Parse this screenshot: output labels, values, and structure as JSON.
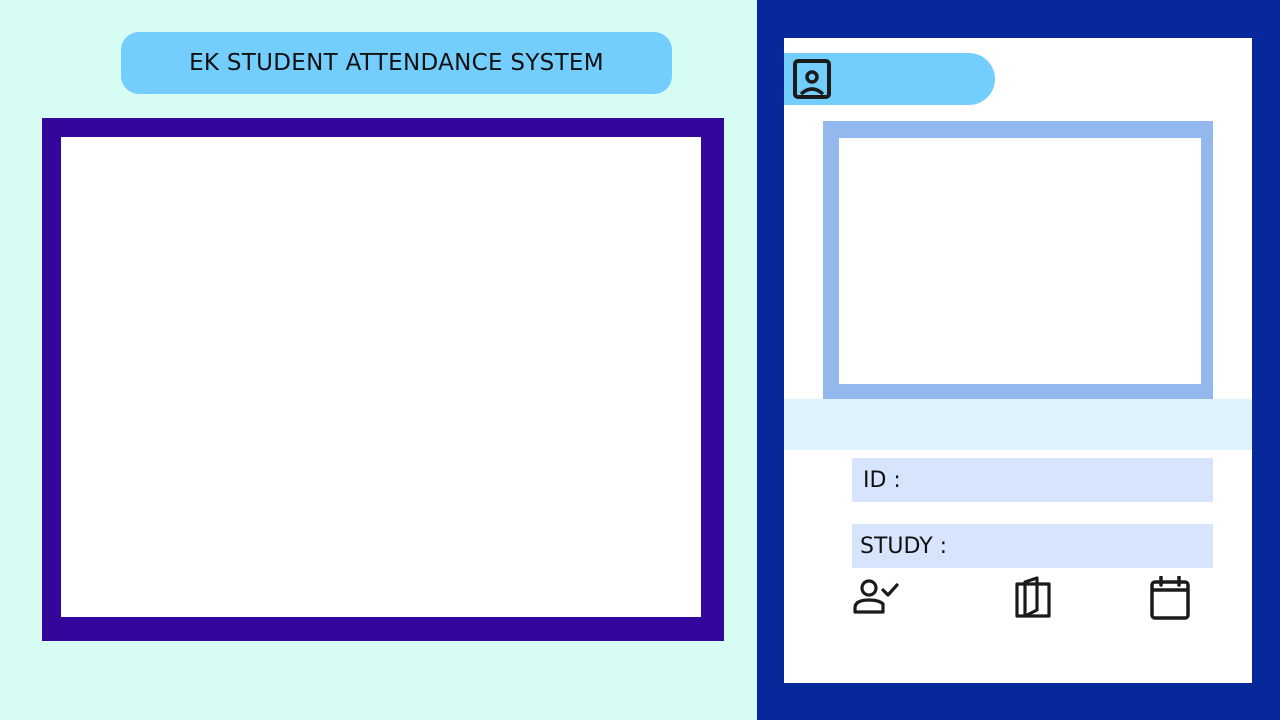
{
  "app": {
    "title": "EK STUDENT ATTENDANCE SYSTEM"
  },
  "profile_panel": {
    "header_icon": "profile-badge-icon",
    "fields": [
      {
        "label": "ID :"
      },
      {
        "label": "STUDY :"
      }
    ],
    "actions": [
      {
        "icon": "user-check-icon"
      },
      {
        "icon": "book-icon"
      },
      {
        "icon": "calendar-icon"
      }
    ]
  },
  "colors": {
    "left_background": "#d6fcf4",
    "accent_light_blue": "#73cdfd",
    "camera_frame": "#33069c",
    "right_background": "#06289b",
    "photo_frame": "#93b8ee",
    "field_background": "#d6e5fc",
    "name_band": "#dff2fe"
  }
}
